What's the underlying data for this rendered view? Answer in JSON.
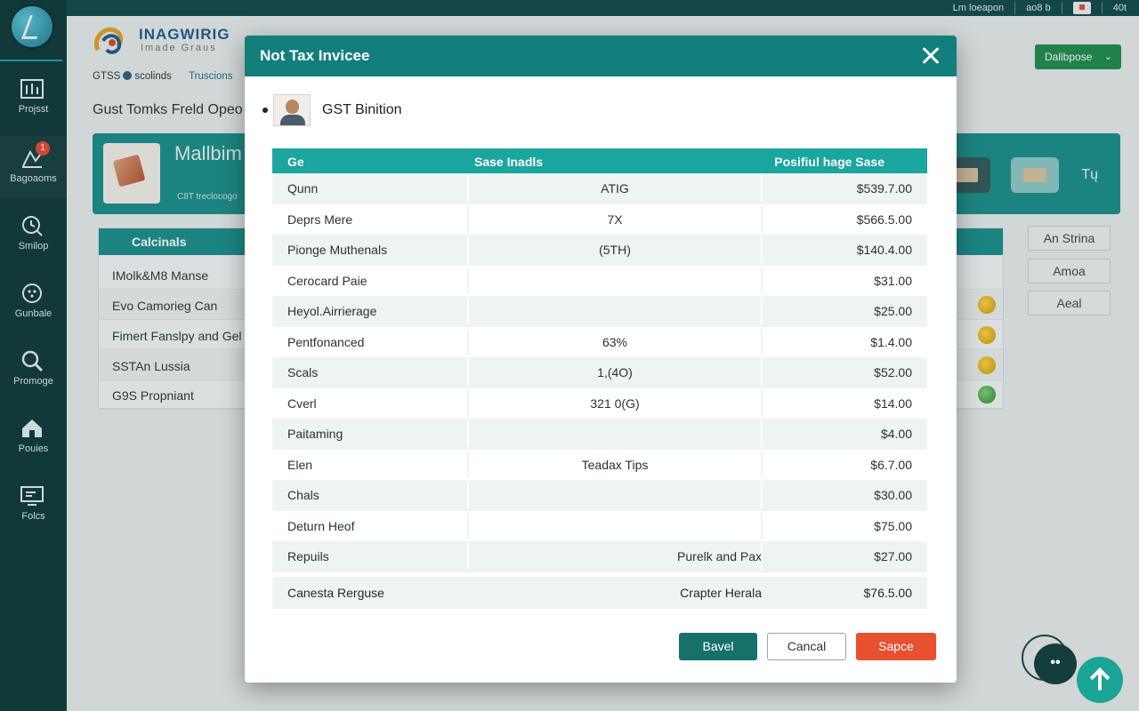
{
  "topbar": {
    "user_text": "Lm loeapon",
    "mid_text": "ao8 b",
    "right_text": "40t"
  },
  "sidebar": {
    "items": [
      {
        "label": "Projsst",
        "icon": "dashboard-icon"
      },
      {
        "label": "Bagoaoms",
        "icon": "chart-icon",
        "badge": "1"
      },
      {
        "label": "Smilop",
        "icon": "clock-search-icon"
      },
      {
        "label": "Gunbale",
        "icon": "settings-icon"
      },
      {
        "label": "Promoge",
        "icon": "search-icon"
      },
      {
        "label": "Pouies",
        "icon": "home-icon"
      },
      {
        "label": "Folcs",
        "icon": "monitor-icon"
      }
    ]
  },
  "brand": {
    "name": "INAGWIRIG",
    "sub": "Imade Graus"
  },
  "breadcrumb": {
    "first": "GTSS",
    "first_suffix": "scolinds",
    "second": "Truscions"
  },
  "page": {
    "heading": "Gust Tomks Freld Opeo"
  },
  "dashboard_button": {
    "label": "Dalibpose",
    "chevron": "⌄"
  },
  "banner": {
    "title": "Mallbim",
    "sub": "C8T treclocogo",
    "tile_label": "Tų"
  },
  "background_table": {
    "header": "Calcinals",
    "rows": [
      "IMolk&M8 Manse",
      "Evo Camorieg Can",
      "Fimert Fanslpy and Gel",
      "SSTAn Lussia",
      "G9S Propniant"
    ]
  },
  "side_buttons": [
    "An Strina",
    "Amoa",
    "Aeal"
  ],
  "modal": {
    "title": "Not Tax Invicee",
    "user_name": "GST Binition",
    "columns": [
      "Ge",
      "Sase Inadls",
      "Posifiul hage Sase"
    ],
    "rows": [
      {
        "name": "Qunn",
        "mid": "ATIG",
        "amount": "$539.7.00"
      },
      {
        "name": "Deprs Mere",
        "mid": "7X",
        "amount": "$566.5.00"
      },
      {
        "name": "Pionge Muthenals",
        "mid": "(5TH)",
        "amount": "$140.4.00"
      },
      {
        "name": "Cerocard Paie",
        "mid": "",
        "amount": "$31.00"
      },
      {
        "name": "Heyol.Airrierage",
        "mid": "",
        "amount": "$25.00"
      },
      {
        "name": "Pentfonanced",
        "mid": "63%",
        "amount": "$1.4.00"
      },
      {
        "name": "Scals",
        "mid": "1,(4O)",
        "amount": "$52.00"
      },
      {
        "name": "Cverl",
        "mid": "321 0(G)",
        "amount": "$14.00"
      },
      {
        "name": "Paitaming",
        "mid": "",
        "amount": "$4.00"
      },
      {
        "name": "Elen",
        "mid": "Teadax Tips",
        "amount": "$6.7.00"
      },
      {
        "name": "Chals",
        "mid": "",
        "amount": "$30.00"
      },
      {
        "name": "Deturn Heof",
        "mid": "",
        "amount": "$75.00"
      },
      {
        "name": "Repuils",
        "mid": "Purelk and Pax",
        "amount": "$27.00"
      }
    ],
    "total": {
      "name": "Canesta Rerguse",
      "mid": "Crapter Herala",
      "amount": "$76.5.00"
    },
    "buttons": {
      "back": "Bavel",
      "cancel": "Cancal",
      "save": "Sapce"
    }
  },
  "fab": {
    "chat_label": "••"
  },
  "colors": {
    "sidebar": "#0e3a3b",
    "accent": "#127f7c",
    "save": "#e8502f",
    "dashboard": "#1f8c4c"
  }
}
